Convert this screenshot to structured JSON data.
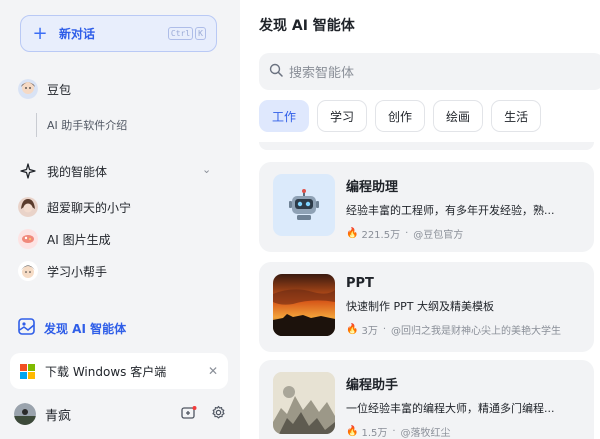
{
  "sidebar": {
    "new_chat": {
      "label": "新对话",
      "shortcut": [
        "Ctrl",
        "K"
      ]
    },
    "doubao": {
      "name": "豆包",
      "sub_item": "AI 助手软件介绍"
    },
    "my_agents": {
      "label": "我的智能体"
    },
    "agents": [
      {
        "label": "超爱聊天的小宁"
      },
      {
        "label": "AI 图片生成"
      },
      {
        "label": "学习小帮手"
      }
    ],
    "discover": {
      "label": "发现 AI 智能体"
    },
    "download": {
      "label": "下载 Windows 客户端"
    },
    "user": {
      "name": "青疯"
    }
  },
  "main": {
    "title": "发现 AI 智能体",
    "search_placeholder": "搜索智能体",
    "tabs": [
      {
        "label": "工作",
        "active": true
      },
      {
        "label": "学习"
      },
      {
        "label": "创作"
      },
      {
        "label": "绘画"
      },
      {
        "label": "生活"
      }
    ],
    "cards": [
      {
        "title": "编程助理",
        "desc": "经验丰富的工程师，有多年开发经验，熟...",
        "count": "221.5万",
        "author": "@豆包官方"
      },
      {
        "title": "PPT",
        "desc": "快速制作 PPT 大纲及精美模板",
        "count": "3万",
        "author": "@回归之我是财神心尖上的美艳大学生"
      },
      {
        "title": "编程助手",
        "desc": "一位经验丰富的编程大师，精通多门编程...",
        "count": "1.5万",
        "author": "@落牧红尘"
      }
    ]
  },
  "colors": {
    "accent": "#2f5ee8",
    "sidebar_bg": "#f3f4f6",
    "card_bg": "#f2f3f5",
    "active_tab_bg": "#dfe8fd"
  }
}
